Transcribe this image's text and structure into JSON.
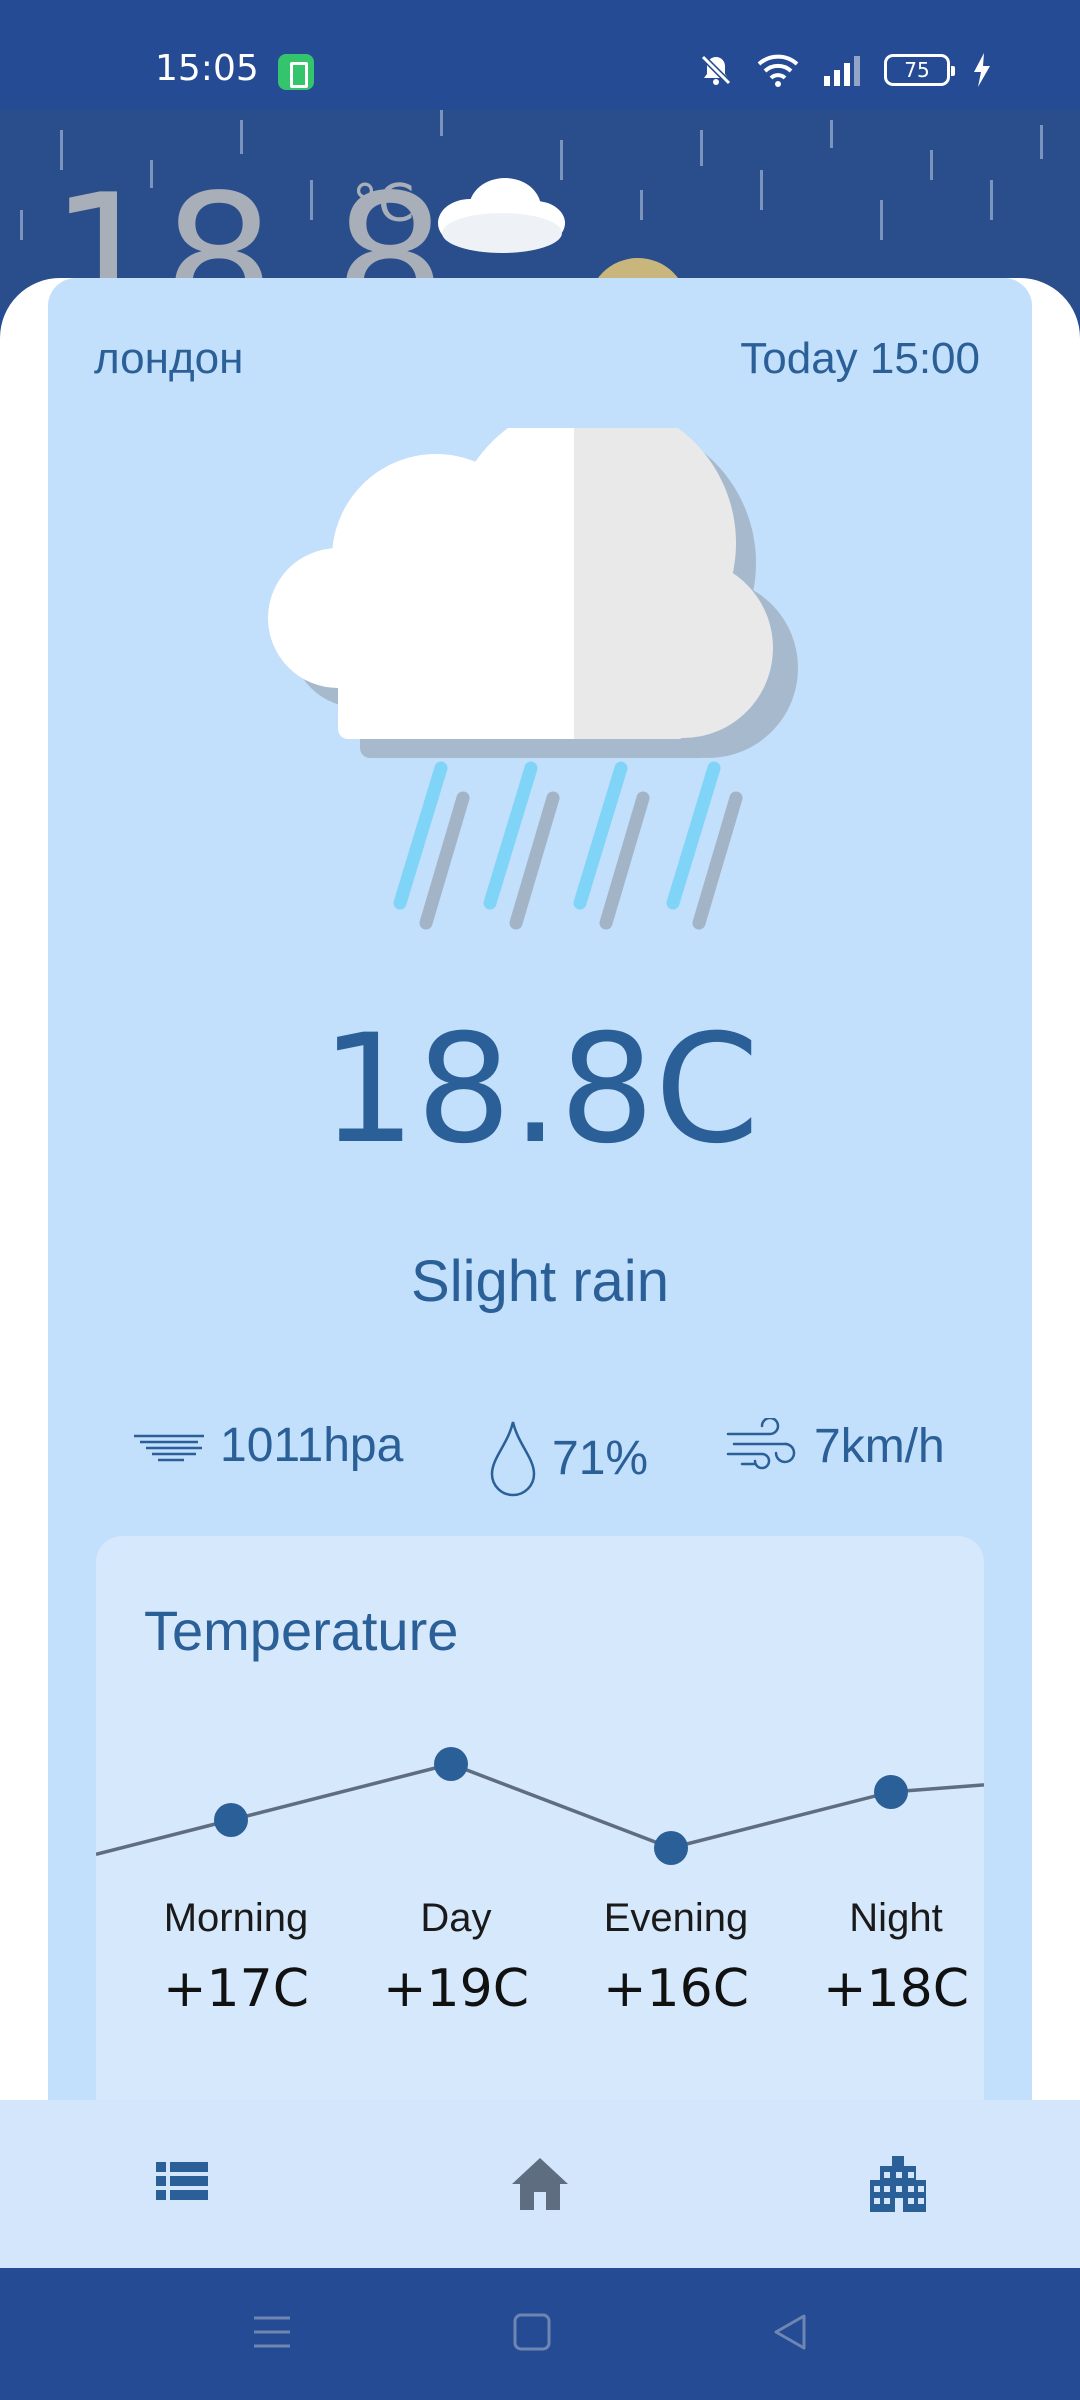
{
  "status_bar": {
    "time": "15:05",
    "battery": "75",
    "icons": [
      "battery-saver-icon",
      "mute-icon",
      "wifi-icon",
      "signal-icon",
      "battery-icon",
      "charging-icon"
    ]
  },
  "hero": {
    "temperature": "18.8",
    "unit": "°C"
  },
  "location": {
    "city": "лондон",
    "datetime": "Today 15:00"
  },
  "current": {
    "temperature": "18.8C",
    "condition": "Slight rain",
    "icon": "cloud-rain-icon"
  },
  "stats": {
    "pressure": "1011hpa",
    "humidity": "71%",
    "wind": "7km/h"
  },
  "temperature_panel": {
    "title": "Temperature",
    "periods": [
      {
        "label": "Morning",
        "value": "+17C"
      },
      {
        "label": "Day",
        "value": "+19C"
      },
      {
        "label": "Evening",
        "value": "+16C"
      },
      {
        "label": "Night",
        "value": "+18C"
      }
    ]
  },
  "chart_data": {
    "type": "line",
    "categories": [
      "Morning",
      "Day",
      "Evening",
      "Night"
    ],
    "values": [
      17,
      19,
      16,
      18
    ],
    "title": "Temperature",
    "xlabel": "",
    "ylabel": "",
    "grid": false
  },
  "colors": {
    "status_bar": "#244b93",
    "card": "#c2dffb",
    "panel": "#d6e8fc",
    "accent_text": "#2b5f97",
    "chart_point": "#2b5f97",
    "chart_line": "#5f6d80"
  },
  "bottom_nav": {
    "items": [
      "list-icon",
      "home-icon",
      "city-icon"
    ]
  },
  "system_nav": {
    "items": [
      "menu-icon",
      "home-square-icon",
      "back-icon"
    ]
  }
}
